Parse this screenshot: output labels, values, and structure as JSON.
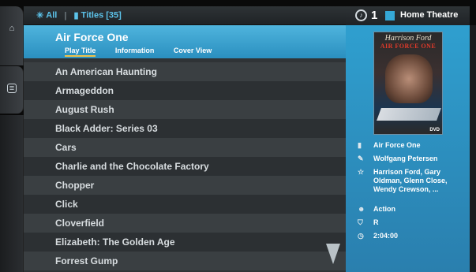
{
  "topbar": {
    "filter_all": "All",
    "filter_separator": "|",
    "filter_titles": "Titles [35]"
  },
  "status": {
    "notification_count": "1",
    "zone_label": "Home Theatre",
    "zone_color": "#35a8d6"
  },
  "list": {
    "selected": {
      "title": "Air Force One",
      "actions": [
        "Play Title",
        "Information",
        "Cover View"
      ],
      "active_action": "Play Title"
    },
    "items": [
      "An American Haunting",
      "Armageddon",
      "August Rush",
      "Black Adder: Series 03",
      "Cars",
      "Charlie and the Chocolate Factory",
      "Chopper",
      "Click",
      "Cloverfield",
      "Elizabeth: The Golden Age",
      "Forrest Gump"
    ]
  },
  "details": {
    "poster": {
      "top_text": "Harrison Ford",
      "title_text": "AIR FORCE ONE",
      "badge": "DVD"
    },
    "title": "Air Force One",
    "director": "Wolfgang Petersen",
    "cast": "Harrison Ford, Gary Oldman, Glenn Close, Wendy Crewson, ...",
    "genre": "Action",
    "rating": "R",
    "runtime": "2:04:00"
  },
  "colors": {
    "accent_blue": "#35a8d6",
    "selected_row": "#3ea3d2",
    "underline": "#f0c34a"
  },
  "icons": {
    "rail_top": "home-icon",
    "rail_mid": "media-icon",
    "title": "title-icon",
    "director": "director-icon",
    "cast": "star-icon",
    "genre": "masks-icon",
    "rating": "shield-icon",
    "runtime": "clock-icon"
  }
}
